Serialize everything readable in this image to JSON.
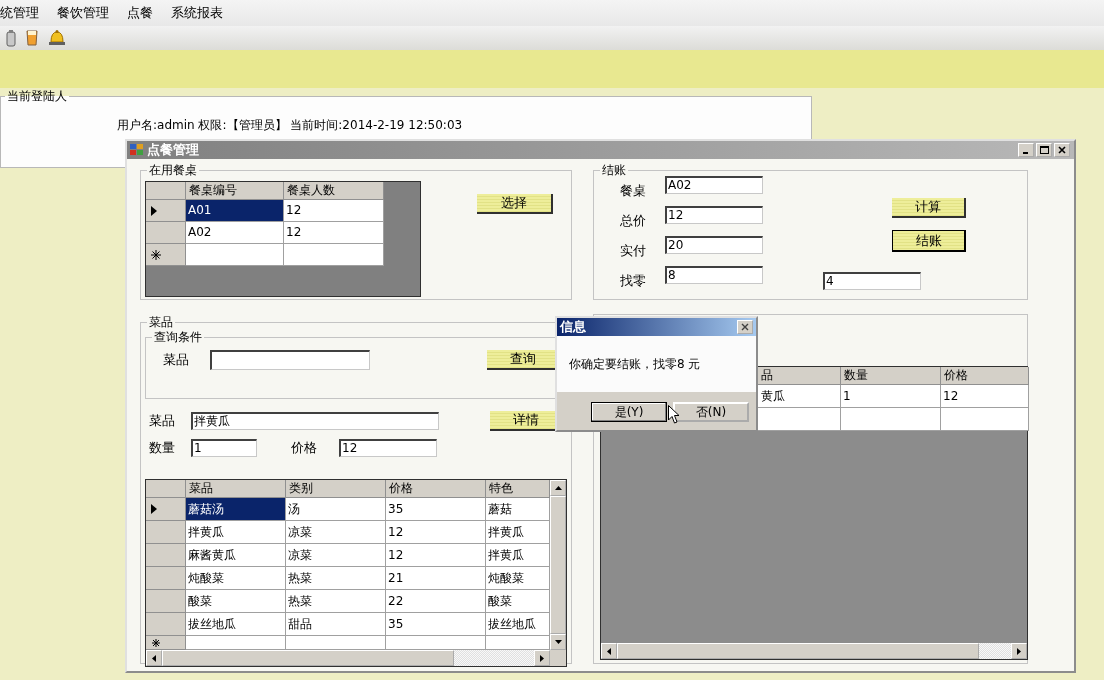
{
  "menu": [
    "统管理",
    "餐饮管理",
    "点餐",
    "系统报表"
  ],
  "login_panel": {
    "title": "当前登陆人",
    "info": "用户名:admin 权限:【管理员】 当前时间:2014-2-19 12:50:03"
  },
  "window": {
    "title": "点餐管理"
  },
  "tables": {
    "title": "在用餐桌",
    "columns": [
      "餐桌编号",
      "餐桌人数"
    ],
    "rows": [
      {
        "cells": [
          "A01",
          "12"
        ],
        "selected": true
      },
      {
        "cells": [
          "A02",
          "12"
        ],
        "selected": false
      }
    ],
    "button": "选择"
  },
  "checkout": {
    "title": "结账",
    "fields": [
      {
        "label": "餐桌",
        "value": "A02"
      },
      {
        "label": "总价",
        "value": "12"
      },
      {
        "label": "实付",
        "value": "20"
      },
      {
        "label": "找零",
        "value": "8"
      }
    ],
    "calc_button": "计算",
    "pay_button": "结账",
    "extra_value": "4"
  },
  "dishes": {
    "title": "菜品",
    "query": {
      "title": "查询条件",
      "label": "菜品",
      "button": "查询"
    },
    "dish_label": "菜品",
    "dish_value": "拌黄瓜",
    "detail_button": "详情",
    "qty_label": "数量",
    "qty_value": "1",
    "price_label": "价格",
    "price_value": "12",
    "columns": [
      "菜品",
      "类别",
      "价格",
      "特色"
    ],
    "rows": [
      {
        "cells": [
          "蘑菇汤",
          "汤",
          "35",
          "蘑菇"
        ],
        "selected": true
      },
      {
        "cells": [
          "拌黄瓜",
          "凉菜",
          "12",
          "拌黄瓜"
        ],
        "selected": false
      },
      {
        "cells": [
          "麻酱黄瓜",
          "凉菜",
          "12",
          "拌黄瓜"
        ],
        "selected": false
      },
      {
        "cells": [
          "炖酸菜",
          "热菜",
          "21",
          "炖酸菜"
        ],
        "selected": false
      },
      {
        "cells": [
          "酸菜",
          "热菜",
          "22",
          "酸菜"
        ],
        "selected": false
      },
      {
        "cells": [
          "拔丝地瓜",
          "甜品",
          "35",
          "拔丝地瓜"
        ],
        "selected": false
      }
    ]
  },
  "ordered": {
    "columns": [
      "品",
      "数量",
      "价格"
    ],
    "rows": [
      {
        "cells": [
          "黄瓜",
          "1",
          "12"
        ]
      }
    ]
  },
  "dialog": {
    "title": "信息",
    "message": "你确定要结账，找零8 元",
    "buttons": [
      "是(Y)",
      "否(N)"
    ]
  }
}
